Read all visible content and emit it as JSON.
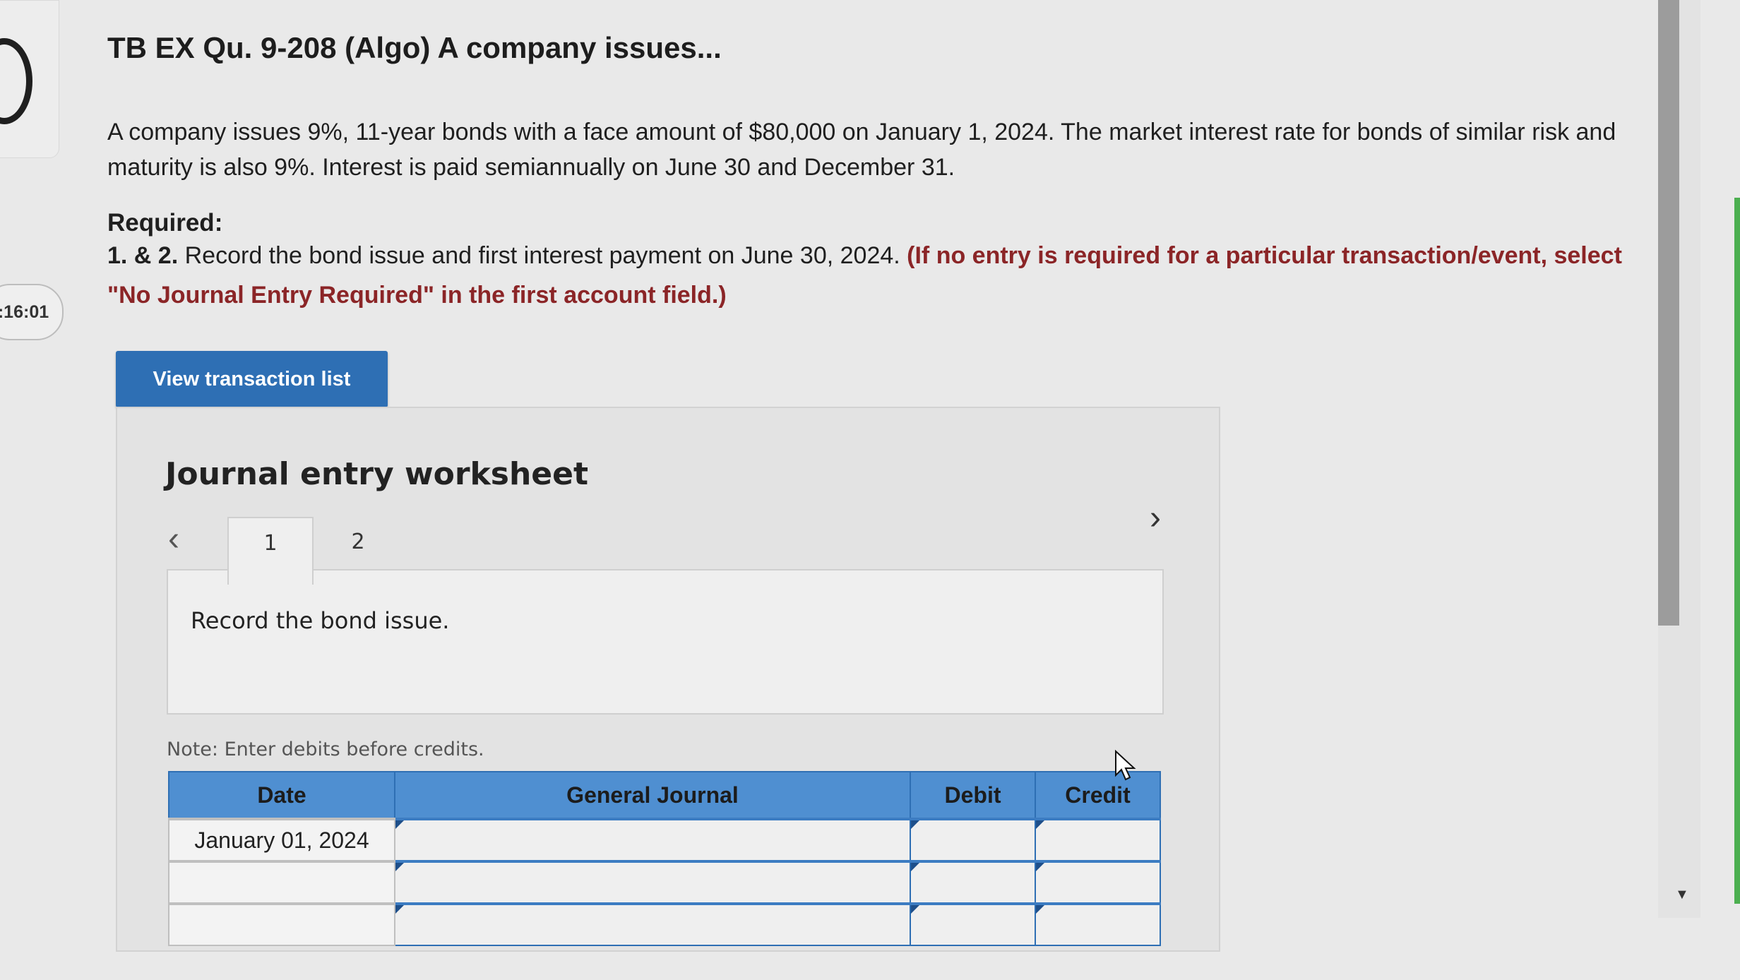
{
  "timer": {
    "text": ":16:01"
  },
  "question": {
    "title": "TB EX Qu. 9-208 (Algo) A company issues...",
    "intro": "A company issues 9%, 11-year bonds with a face amount of $80,000 on January 1, 2024. The market interest rate for bonds of similar risk and maturity is also 9%. Interest is paid semiannually on June 30 and December 31.",
    "required_label": "Required:",
    "req_number": "1. & 2.",
    "req_text": "Record the bond issue and first interest payment on June 30, 2024.",
    "req_emphasis": "(If no entry is required for a particular transaction/event, select \"No Journal Entry Required\" in the first account field.)"
  },
  "buttons": {
    "view_transactions": "View transaction list"
  },
  "worksheet": {
    "title": "Journal entry worksheet",
    "tabs": [
      "1",
      "2"
    ],
    "active_tab": "1",
    "tab_content": "Record the bond issue.",
    "note": "Note: Enter debits before credits.",
    "table": {
      "headers": {
        "date": "Date",
        "journal": "General Journal",
        "debit": "Debit",
        "credit": "Credit"
      },
      "rows": [
        {
          "date": "January 01, 2024",
          "account": "",
          "debit": "",
          "credit": ""
        },
        {
          "date": "",
          "account": "",
          "debit": "",
          "credit": ""
        },
        {
          "date": "",
          "account": "",
          "debit": "",
          "credit": ""
        }
      ]
    }
  }
}
